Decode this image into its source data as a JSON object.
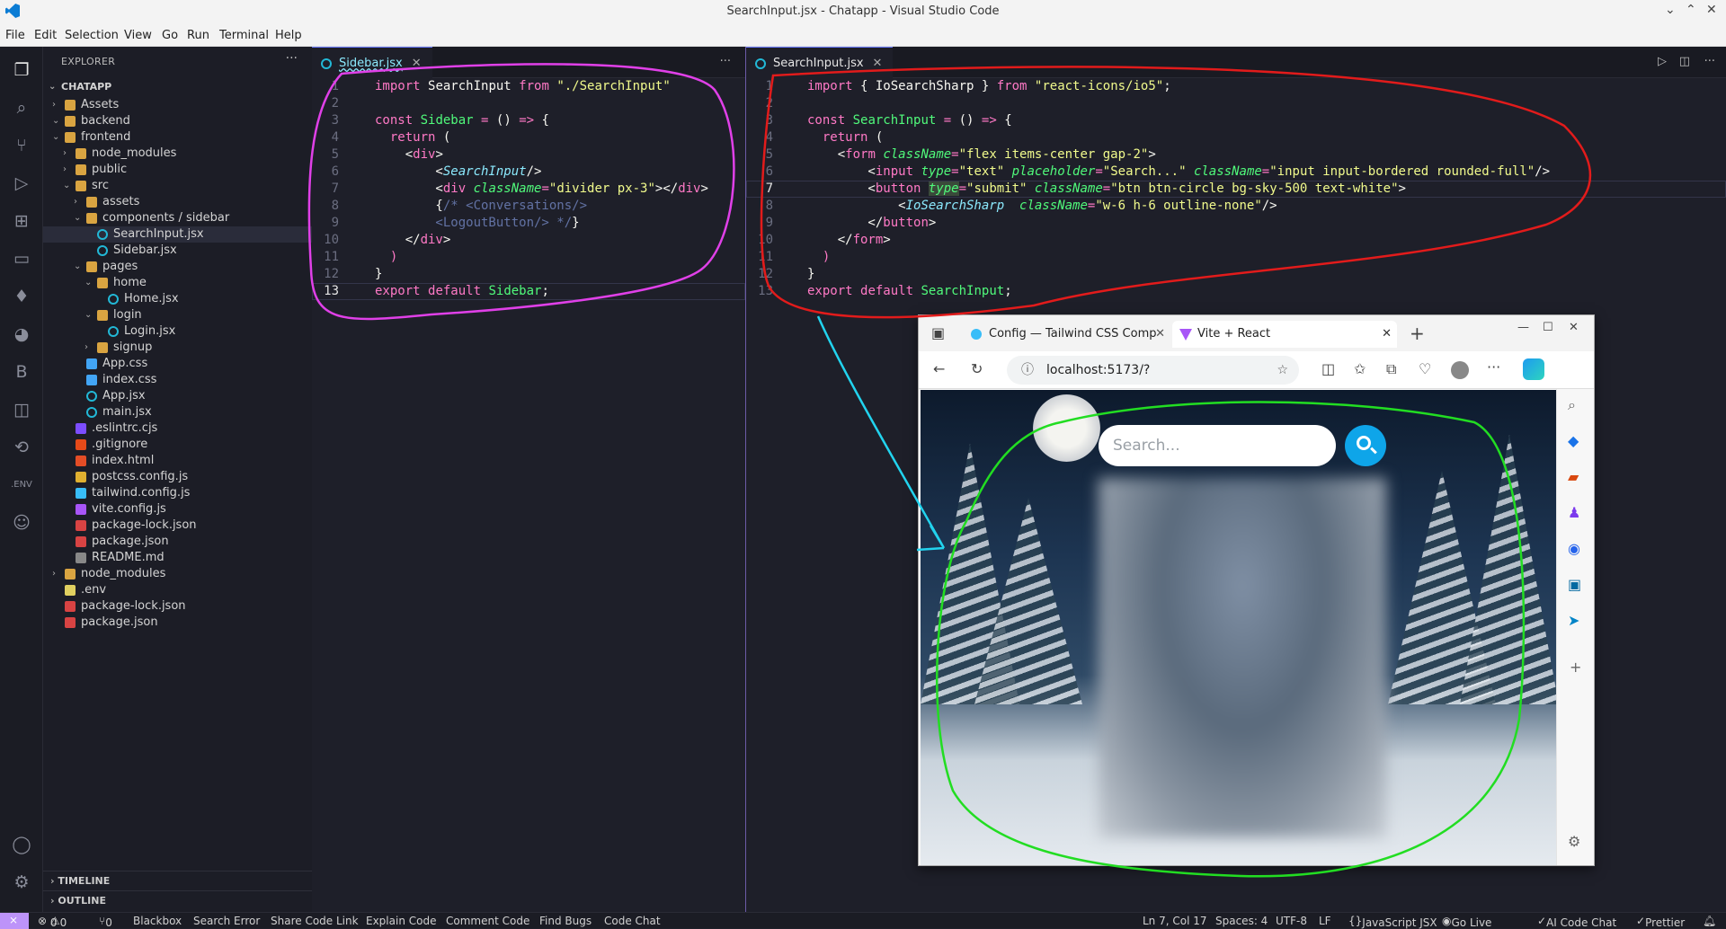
{
  "window": {
    "title": "SearchInput.jsx - Chatapp - Visual Studio Code"
  },
  "menu": [
    "File",
    "Edit",
    "Selection",
    "View",
    "Go",
    "Run",
    "Terminal",
    "Help"
  ],
  "explorer": {
    "header": "EXPLORER",
    "root": "CHATAPP",
    "items": [
      "Assets",
      "backend",
      "frontend",
      "node_modules",
      "public",
      "src",
      "assets",
      "components / sidebar",
      "SearchInput.jsx",
      "Sidebar.jsx",
      "pages",
      "home",
      "Home.jsx",
      "login",
      "Login.jsx",
      "signup",
      "App.css",
      "index.css",
      "App.jsx",
      "main.jsx",
      ".eslintrc.cjs",
      ".gitignore",
      "index.html",
      "postcss.config.js",
      "tailwind.config.js",
      "vite.config.js",
      "package-lock.json",
      "package.json",
      "README.md",
      "node_modules",
      ".env",
      "package-lock.json",
      "package.json"
    ],
    "timeline": "TIMELINE",
    "outline": "OUTLINE"
  },
  "left_editor": {
    "tab": "Sidebar.jsx",
    "line_numbers": [
      "1",
      "2",
      "3",
      "4",
      "5",
      "6",
      "7",
      "8",
      "9",
      "10",
      "11",
      "12",
      "13"
    ]
  },
  "right_editor": {
    "tab": "SearchInput.jsx",
    "line_numbers": [
      "1",
      "2",
      "3",
      "4",
      "5",
      "6",
      "7",
      "8",
      "9",
      "10",
      "11",
      "12",
      "13"
    ]
  },
  "browser": {
    "tab1": "Config — Tailwind CSS Comp",
    "tab2": "Vite + React",
    "url": "localhost:5173/?",
    "search_placeholder": "Search..."
  },
  "status": {
    "errors": "0",
    "warnings": "0",
    "ports": "0",
    "items": [
      "Blackbox",
      "Search Error",
      "Share Code Link",
      "Explain Code",
      "Comment Code",
      "Find Bugs",
      "Code Chat"
    ],
    "position": "Ln 7, Col 17",
    "spaces": "Spaces: 4",
    "encoding": "UTF-8",
    "eol": "LF",
    "language": "JavaScript JSX",
    "golive": "Go Live",
    "aichat": "AI Code Chat",
    "prettier": "Prettier"
  }
}
